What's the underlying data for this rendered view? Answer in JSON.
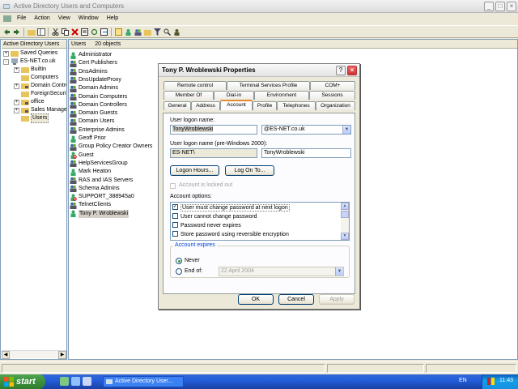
{
  "window": {
    "title": "Active Directory Users and Computers",
    "controls": [
      "_",
      "□",
      "×"
    ]
  },
  "menu": [
    "File",
    "Action",
    "View",
    "Window",
    "Help"
  ],
  "tree": {
    "header": "Active Directory Users",
    "nodes": [
      {
        "label": "Saved Queries",
        "expander": "+"
      },
      {
        "label": "ES-NET.co.uk",
        "expander": "-"
      },
      {
        "label": "Builtin",
        "expander": "+"
      },
      {
        "label": "Computers",
        "expander": ""
      },
      {
        "label": "Domain Contro",
        "expander": "+"
      },
      {
        "label": "ForeignSecuri",
        "expander": ""
      },
      {
        "label": "office",
        "expander": "+"
      },
      {
        "label": "Sales Manager",
        "expander": "+"
      },
      {
        "label": "Users",
        "expander": ""
      }
    ]
  },
  "list": {
    "header_name": "Users",
    "header_count": "20 objects",
    "items": [
      {
        "name": "Administrator",
        "icon": "user-icon"
      },
      {
        "name": "Cert Publishers",
        "icon": "group-icon"
      },
      {
        "name": "DnsAdmins",
        "icon": "group-icon"
      },
      {
        "name": "DnsUpdateProxy",
        "icon": "group-icon"
      },
      {
        "name": "Domain Admins",
        "icon": "group-icon"
      },
      {
        "name": "Domain Computers",
        "icon": "group-icon"
      },
      {
        "name": "Domain Controllers",
        "icon": "group-icon"
      },
      {
        "name": "Domain Guests",
        "icon": "group-icon"
      },
      {
        "name": "Domain Users",
        "icon": "group-icon"
      },
      {
        "name": "Enterprise Admins",
        "icon": "group-icon"
      },
      {
        "name": "Geoff Prior",
        "icon": "user-icon"
      },
      {
        "name": "Group Policy Creator Owners",
        "icon": "group-icon"
      },
      {
        "name": "Guest",
        "icon": "user-disabled-icon"
      },
      {
        "name": "HelpServicesGroup",
        "icon": "group-icon"
      },
      {
        "name": "Mark Heaton",
        "icon": "user-icon"
      },
      {
        "name": "RAS and IAS Servers",
        "icon": "group-icon"
      },
      {
        "name": "Schema Admins",
        "icon": "group-icon"
      },
      {
        "name": "SUPPORT_388945a0",
        "icon": "user-disabled-icon"
      },
      {
        "name": "TelnetClients",
        "icon": "group-icon"
      },
      {
        "name": "Tony P. Wroblewski",
        "icon": "user-icon"
      }
    ]
  },
  "dialog": {
    "title": "Tony P. Wroblewski Properties",
    "tabs_row1": [
      "Remote control",
      "Terminal Services Profile",
      "COM+"
    ],
    "tabs_row2": [
      "Member Of",
      "Dial-in",
      "Environment",
      "Sessions"
    ],
    "tabs_row3": [
      "General",
      "Address",
      "Account",
      "Profile",
      "Telephones",
      "Organization"
    ],
    "active_tab": "Account",
    "logon_name_label": "User logon name:",
    "logon_name_value": "TonyWroblewski",
    "domain_value": "@ES-NET.co.uk",
    "pre2000_label": "User logon name (pre-Windows 2000):",
    "pre2000_domain": "ES-NET\\",
    "pre2000_value": "TonyWroblewski",
    "logon_hours_btn": "Logon Hours...",
    "logon_to_btn": "Log On To...",
    "locked_out_label": "Account is locked out",
    "options_label": "Account options:",
    "options": [
      {
        "label": "User must change password at next logon",
        "checked": true
      },
      {
        "label": "User cannot change password",
        "checked": false
      },
      {
        "label": "Password never expires",
        "checked": false
      },
      {
        "label": "Store password using reversible encryption",
        "checked": false
      }
    ],
    "expires_label": "Account expires",
    "never_label": "Never",
    "endof_label": "End of:",
    "endof_date": "22    April    2004",
    "ok": "OK",
    "cancel": "Cancel",
    "apply": "Apply"
  },
  "taskbar": {
    "start": "start",
    "task": "Active Directory User...",
    "lang": "EN",
    "clock": "11:43"
  },
  "colors": {
    "taskbar": "#245edb",
    "start": "#3c8f3c",
    "tab_highlight": "#e68b2c",
    "group_label": "#0046d5"
  }
}
